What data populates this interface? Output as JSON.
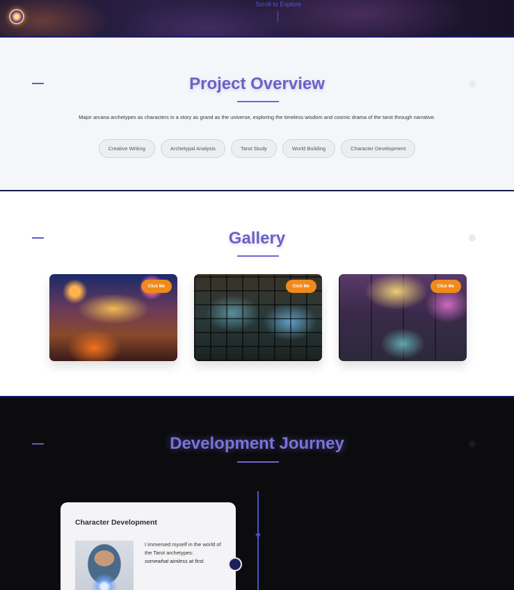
{
  "hero": {
    "link_label": "Scroll to Explore"
  },
  "overview": {
    "title": "Project Overview",
    "description": "Major arcana archetypes as characters in a story as grand as the universe, exploring the timeless wisdom and cosmic drama of the tarot through narrative.",
    "tags": [
      "Creative Writing",
      "Archetypal Analysis",
      "Tarot Study",
      "World Building",
      "Character Development"
    ]
  },
  "gallery": {
    "title": "Gallery",
    "items": [
      {
        "button_label": "Click Me"
      },
      {
        "button_label": "Click Me"
      },
      {
        "button_label": "Click Me"
      }
    ]
  },
  "journey": {
    "title": "Development Journey",
    "card": {
      "title": "Character Development",
      "text": "I immersed myself in the world of the Tarot archetypes:",
      "text_emphasis": "somewhat aimless at first."
    }
  },
  "colors": {
    "accent": "#6a62c4",
    "button": "#f08a1c",
    "timeline": "#4b56c6"
  }
}
